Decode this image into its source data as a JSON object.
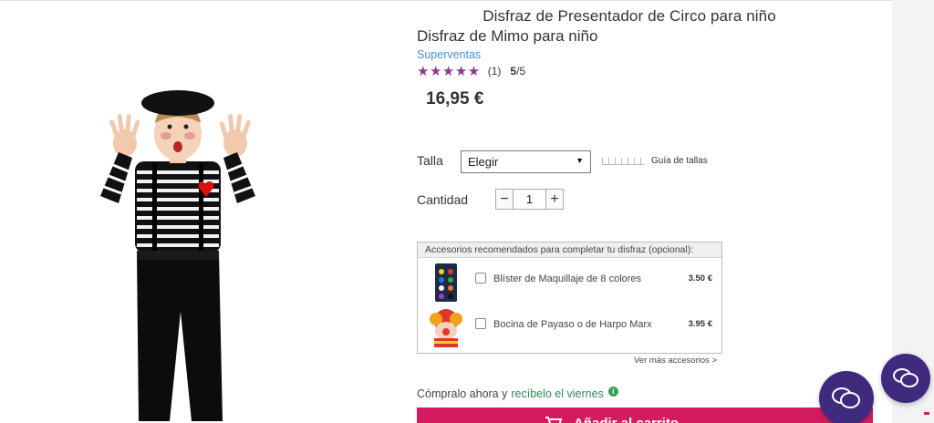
{
  "header": {
    "title": "Disfraz de Presentador de Circo para niño"
  },
  "product": {
    "title": "Disfraz de Mimo para niño",
    "badge": "Superventas",
    "stars": "★★★★★",
    "review_count": "(1)",
    "score_value": "5",
    "score_max": "/5",
    "price": "16,95 €",
    "image_icon": "mime-costume-photo"
  },
  "size": {
    "label": "Talla",
    "selected": "Elegir",
    "guide_label": "Guía de tallas"
  },
  "quantity": {
    "label": "Cantidad",
    "minus": "−",
    "value": "1",
    "plus": "+"
  },
  "accessories": {
    "header": "Accesorios recomendados para completar tu disfraz (opcional):",
    "items": [
      {
        "name": "Blíster de Maquillaje de 8 colores",
        "price": "3.50 €",
        "checked": false,
        "icon": "makeup-palette-icon"
      },
      {
        "name": "Bocina de Payaso o de Harpo Marx",
        "price": "3.95 €",
        "checked": false,
        "icon": "clown-horn-icon"
      }
    ],
    "more_link": "Ver más accesorios >"
  },
  "delivery": {
    "prefix": "Cómpralo ahora y",
    "highlight": "recíbelo el viernes",
    "info_icon": "i"
  },
  "cart": {
    "label": "Añadir al carrito"
  },
  "colors": {
    "brand": "#d51b5f",
    "stars": "#8c3a8e",
    "chat": "#3f2a7e",
    "link": "#4a90c8",
    "green": "#2e8b57"
  }
}
